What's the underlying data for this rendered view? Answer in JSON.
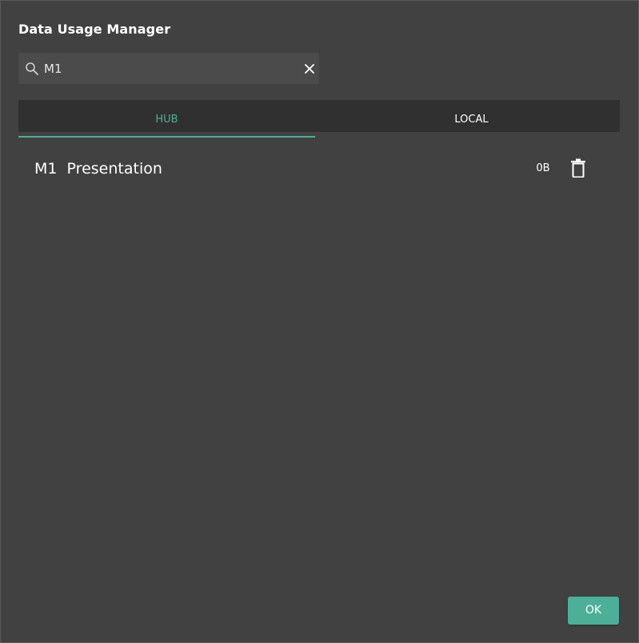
{
  "dialog": {
    "title": "Data Usage Manager"
  },
  "search": {
    "value": "M1",
    "placeholder": "",
    "icon": "search-icon",
    "clear_icon": "close-icon"
  },
  "tabs": [
    {
      "label": "HUB",
      "active": true
    },
    {
      "label": "LOCAL",
      "active": false
    }
  ],
  "items": [
    {
      "name": "M1  Presentation",
      "size": "0B",
      "action_icon": "trash-icon"
    }
  ],
  "footer": {
    "ok_label": "OK"
  },
  "colors": {
    "accent": "#4caf98",
    "background": "#414141",
    "tab_bar": "#303030",
    "search_bg": "#4b4b4b"
  }
}
